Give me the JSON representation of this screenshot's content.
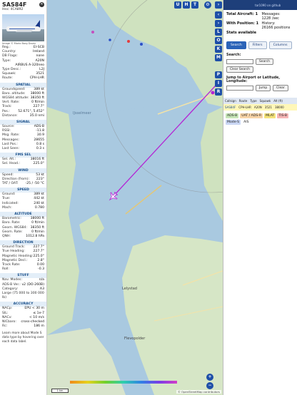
{
  "aircraft": {
    "callsign": "SAS84F",
    "hex": "Hex: 4CA892",
    "photo_credit": "Image © Mario Borg Dover"
  },
  "info_rows": [
    {
      "k": "Reg.:",
      "v": "EI-SCB"
    },
    {
      "k": "Country:",
      "v": "Ireland"
    },
    {
      "k": "DB Flags:",
      "v": "none"
    },
    {
      "k": "Type:",
      "v": "A20N"
    },
    {
      "k": "",
      "v": "AIRBUS A-320neo"
    },
    {
      "k": "Type Desc.:",
      "v": "L2J"
    },
    {
      "k": "Squawk:",
      "v": "3521"
    },
    {
      "k": "Route:",
      "v": "CPH-LHR"
    }
  ],
  "sections": [
    {
      "title": "SPATIAL",
      "rows": [
        {
          "k": "Groundspeed:",
          "v": "389 kt"
        },
        {
          "k": "Baro. altitude:",
          "v": "38000 ft"
        },
        {
          "k": "WGS84 altitude:",
          "v": "38350 ft"
        },
        {
          "k": "Vert. Rate:",
          "v": "0 ft/min"
        },
        {
          "k": "Track:",
          "v": "227.7°"
        },
        {
          "k": "Pos.:",
          "v": "52.671°, 5.452°"
        },
        {
          "k": "Distance:",
          "v": "35.0 nmi"
        }
      ]
    },
    {
      "title": "SIGNAL",
      "rows": [
        {
          "k": "Source:",
          "v": "ADS-B"
        },
        {
          "k": "RSSI:",
          "v": "-11.8"
        },
        {
          "k": "Msg. Rate:",
          "v": "30.9"
        },
        {
          "k": "Messages:",
          "v": "28655"
        },
        {
          "k": "Last Pos.:",
          "v": "0.8 s"
        },
        {
          "k": "Last Seen:",
          "v": "0.3 s"
        }
      ]
    },
    {
      "title": "FMS SEL",
      "rows": [
        {
          "k": "Sel. Alt.:",
          "v": "38016 ft"
        },
        {
          "k": "Sel. Head.:",
          "v": "225.0°"
        }
      ]
    },
    {
      "title": "WIND",
      "rows": [
        {
          "k": "Speed:",
          "v": "53 kt"
        },
        {
          "k": "Direction (from):",
          "v": "223°"
        },
        {
          "k": "TAT / OAT:",
          "v": "-25 / -50 °C"
        }
      ]
    },
    {
      "title": "SPEED",
      "rows": [
        {
          "k": "Ground:",
          "v": "389 kt"
        },
        {
          "k": "True:",
          "v": "442 kt"
        },
        {
          "k": "Indicated:",
          "v": "240 kt"
        },
        {
          "k": "Mach:",
          "v": "0.780"
        }
      ]
    },
    {
      "title": "ALTITUDE",
      "rows": [
        {
          "k": "Barometric:",
          "v": "38000 ft"
        },
        {
          "k": "Baro. Rate:",
          "v": "0 ft/min"
        },
        {
          "k": "Geom. WGS84:",
          "v": "38350 ft"
        },
        {
          "k": "Geom. Rate:",
          "v": "0 ft/min"
        },
        {
          "k": "QNH:",
          "v": "1012.8 hPa"
        }
      ]
    },
    {
      "title": "DIRECTION",
      "rows": [
        {
          "k": "Ground Track:",
          "v": "227.7°"
        },
        {
          "k": "True Heading:",
          "v": "227.7°"
        },
        {
          "k": "Magnetic Heading:",
          "v": "225.0°"
        },
        {
          "k": "Magnetic Decl.:",
          "v": "2.8°"
        },
        {
          "k": "Track Rate:",
          "v": "0.00"
        },
        {
          "k": "Roll:",
          "v": "-0.3"
        }
      ]
    },
    {
      "title": "STUFF",
      "rows": [
        {
          "k": "Nav. Modes:",
          "v": "n/a"
        },
        {
          "k": "ADS-B Ver.:",
          "v": "v2 (DO-260B)"
        },
        {
          "k": "Category:",
          "v": "A3"
        },
        {
          "k": "Large (75 000 to 300 000 lb)",
          "v": ""
        }
      ]
    },
    {
      "title": "ACCURACY",
      "rows": [
        {
          "k": "NACp:",
          "v": "EPU < 30 m"
        },
        {
          "k": "SIL:",
          "v": "≤ 1e-7"
        },
        {
          "k": "NACv:",
          "v": "< 10 m/s"
        },
        {
          "k": "NICbaro:",
          "v": "cross-checked"
        },
        {
          "k": "Rc:",
          "v": "186 m"
        }
      ]
    }
  ],
  "footnote": "Learn more about Mode S data type by hovering over each data label.",
  "map": {
    "labels": [
      "IJsselmeer",
      "Lelystad",
      "Flevopolder"
    ],
    "buttons": [
      "U",
      "H",
      "T"
    ],
    "side_buttons": [
      "L",
      "O",
      "K",
      "M",
      "P",
      "I",
      "R"
    ],
    "scale": "1 km",
    "attribution": "© OpenStreetMap contributors"
  },
  "right_panel": {
    "top_link": "tar1090 on github",
    "stats": [
      {
        "k": "Total Aircraft:",
        "v": "1"
      },
      {
        "k": "Messages:",
        "v": "1228 /sec"
      },
      {
        "k": "With Position:",
        "v": "1"
      },
      {
        "k": "History:",
        "v": "26166 positions"
      },
      {
        "k": "Stats available",
        "v": ""
      }
    ],
    "tabs": [
      "Search",
      "Filters",
      "Columns"
    ],
    "search_label": "Search:",
    "search_button": "Search",
    "clear_search": "Clear Search",
    "jump_label": "Jump to Airport or Latitude, Longitude:",
    "jump_button": "Jump",
    "clear_button": "Clear",
    "table_headers": [
      "Callsign",
      "Route",
      "Type",
      "Squawk",
      "Alt (ft)"
    ],
    "table_row": [
      "SAS84F",
      "CPH-LHR",
      "A20N",
      "3521",
      "38000"
    ],
    "legend": [
      {
        "label": "ADS-B",
        "color": "#c6e5b8"
      },
      {
        "label": "UAT / ADS-R",
        "color": "#f7d4a8"
      },
      {
        "label": "MLAT",
        "color": "#f4e27a"
      },
      {
        "label": "TIS-B",
        "color": "#f6b6b6"
      },
      {
        "label": "Mode-S",
        "color": "#c9d6f4"
      },
      {
        "label": "AIS",
        "color": "#ffffff"
      }
    ]
  },
  "colors": {
    "accent": "#1e4fa8",
    "track": "#b424d4",
    "water": "#a9c9e0",
    "land": "#cfe2bf"
  }
}
